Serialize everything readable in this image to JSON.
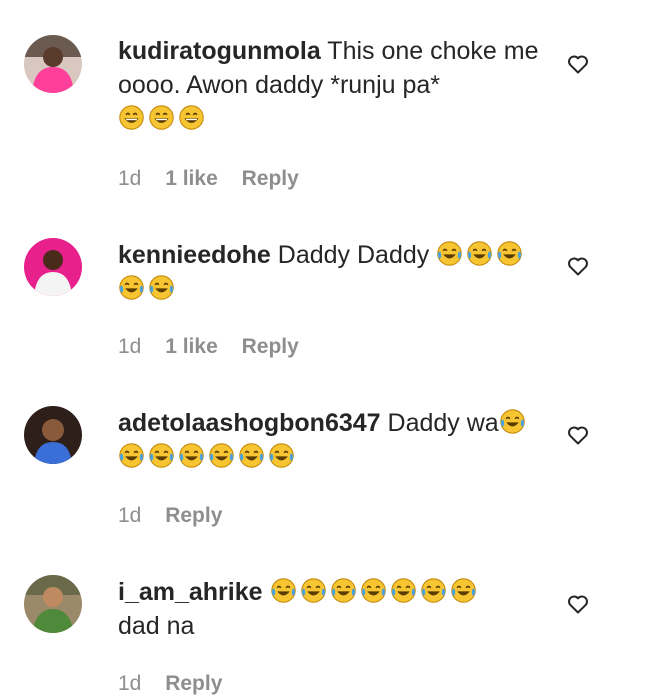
{
  "comments": [
    {
      "username": "kudiratogunmola",
      "text": "This one choke me oooo. Awon daddy *runju pa*",
      "emojis": [
        "grinning-face",
        "grinning-face",
        "grinning-face"
      ],
      "time": "1d",
      "likes": "1 like",
      "reply": "Reply",
      "avatar_icon": "pink-outfit-avatar"
    },
    {
      "username": "kennieedohe",
      "text": "Daddy Daddy",
      "emojis": [
        "tears-of-joy-face",
        "tears-of-joy-face",
        "tears-of-joy-face",
        "tears-of-joy-face",
        "tears-of-joy-face"
      ],
      "time": "1d",
      "likes": "1 like",
      "reply": "Reply",
      "avatar_icon": "pink-background-avatar"
    },
    {
      "username": "adetolaashogbon6347",
      "text": "Daddy wa",
      "emojis": [
        "tears-of-joy-face",
        "tears-of-joy-face",
        "tears-of-joy-face",
        "tears-of-joy-face",
        "tears-of-joy-face",
        "tears-of-joy-face",
        "tears-of-joy-face"
      ],
      "time": "1d",
      "reply": "Reply",
      "avatar_icon": "portrait-avatar"
    },
    {
      "username": "i_am_ahrike",
      "text_after": "dad na",
      "emojis": [
        "tears-of-joy-face",
        "tears-of-joy-face",
        "tears-of-joy-face",
        "tears-of-joy-face",
        "tears-of-joy-face",
        "tears-of-joy-face",
        "tears-of-joy-face"
      ],
      "time": "1d",
      "reply": "Reply",
      "avatar_icon": "green-dress-avatar"
    }
  ],
  "colors": {
    "text": "#262626",
    "meta": "#8e8e8e",
    "emoji_face": "#f7c531",
    "emoji_tear": "#4aa3df"
  }
}
